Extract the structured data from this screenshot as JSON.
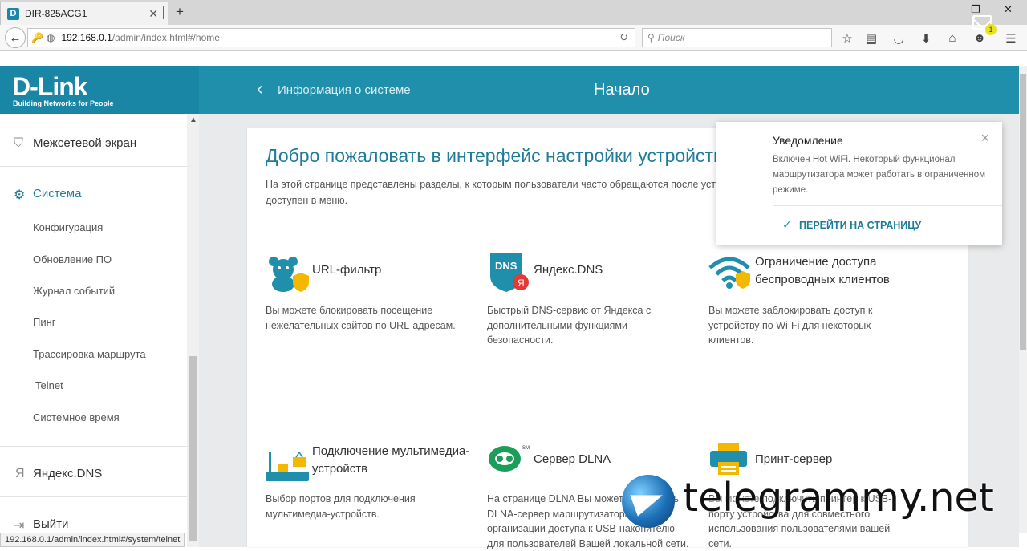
{
  "browser": {
    "tab_title": "DIR-825ACG1",
    "favicon": "D",
    "url_host": "192.168.0.1",
    "url_path": "/admin/index.html#/home",
    "search_placeholder": "Поиск"
  },
  "header": {
    "logo": "D-Link",
    "logo_sub": "Building Networks for People",
    "back_link": "Информация о системе",
    "title": "Начало",
    "notif_count": "1"
  },
  "sidebar": {
    "firewall": "Межсетевой экран",
    "system": "Система",
    "items": [
      "Конфигурация",
      "Обновление ПО",
      "Журнал событий",
      "Пинг",
      "Трассировка маршрута",
      "Telnet",
      "Системное время"
    ],
    "yandex": "Яндекс.DNS",
    "logout": "Выйти"
  },
  "main": {
    "welcome": "Добро пожаловать в интерфейс настройки устройства",
    "intro": "На этой странице представлены разделы, к которым пользователи часто обращаются после установки устройства. Полный список разделов доступен в меню.",
    "tiles": [
      {
        "title": "URL-фильтр",
        "desc": "Вы можете блокировать посещение нежелательных сайтов по URL-адресам."
      },
      {
        "title": "Яндекс.DNS",
        "desc": "Быстрый DNS-сервис от Яндекса с дополнительными функциями безопасности."
      },
      {
        "title": "Ограничение доступа беспроводных клиентов",
        "desc": "Вы можете заблокировать доступ к устройству по Wi-Fi для некоторых клиентов."
      },
      {
        "title": "Подключение мультимедиа-устройств",
        "desc": "Выбор портов для подключения мультимедиа-устройств."
      },
      {
        "title": "Сервер DLNA",
        "desc": "На странице DLNA Вы можете настроить DLNA-сервер маршрутизатора для организации доступа к USB-накопителю для пользователей Вашей локальной сети."
      },
      {
        "title": "Принт-сервер",
        "desc": "Вы можете подключить принтер к USB-порту устройства для совместного использования пользователями вашей сети."
      }
    ]
  },
  "notification": {
    "title": "Уведомление",
    "text": "Включен Hot WiFi. Некоторый функционал маршрутизатора может работать в ограниченном режиме.",
    "link": "ПЕРЕЙТИ НА СТРАНИЦУ"
  },
  "status_bar": "192.168.0.1/admin/index.html#/system/telnet",
  "watermark": "telegrammy.net",
  "colors": {
    "brand": "#1f8fac",
    "accent_text": "#1f7c9b",
    "shield": "#f5b800"
  }
}
